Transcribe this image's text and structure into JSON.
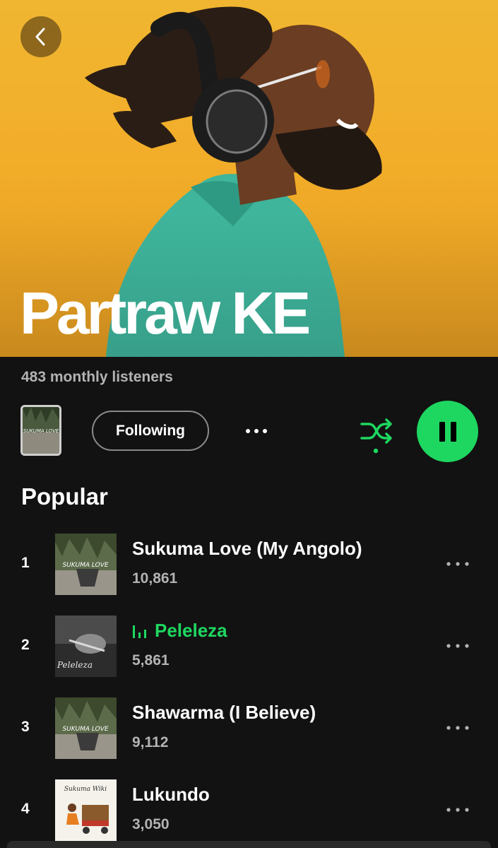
{
  "artist": {
    "name": "Partraw KE",
    "monthly_listeners": "483 monthly listeners"
  },
  "controls": {
    "follow_label": "Following",
    "shuffle_active": true,
    "playing": true
  },
  "colors": {
    "accent": "#1ed760",
    "hero_bg": "#f2ad29",
    "background": "#121212"
  },
  "popular": {
    "title": "Popular",
    "tracks": [
      {
        "rank": "1",
        "title": "Sukuma Love (My Angolo)",
        "plays": "10,861",
        "cover_text": "SUKUMA LOVE",
        "playing": false
      },
      {
        "rank": "2",
        "title": "Peleleza",
        "plays": "5,861",
        "cover_text": "Peleleza",
        "playing": true
      },
      {
        "rank": "3",
        "title": "Shawarma (I Believe)",
        "plays": "9,112",
        "cover_text": "SUKUMA LOVE",
        "playing": false
      },
      {
        "rank": "4",
        "title": "Lukundo",
        "plays": "3,050",
        "cover_text": "Sukuma Wiki",
        "playing": false
      }
    ]
  }
}
